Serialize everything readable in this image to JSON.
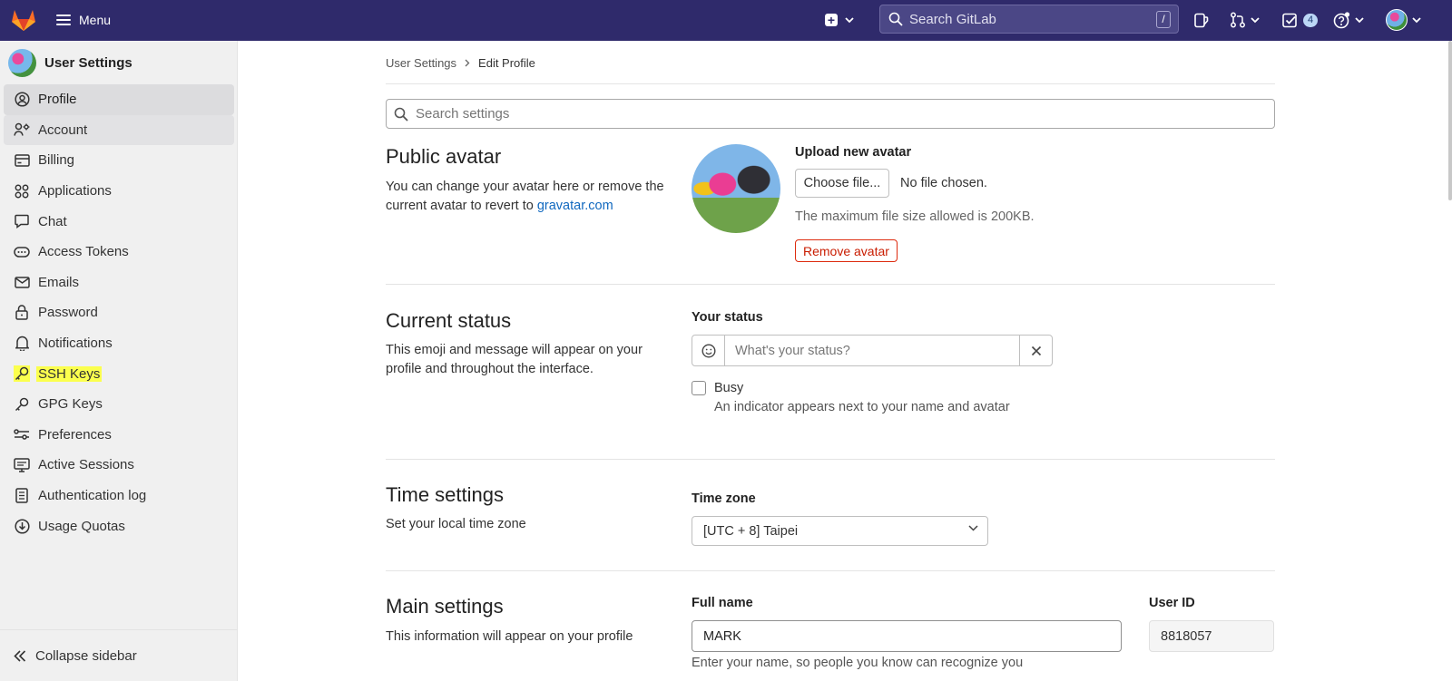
{
  "topbar": {
    "menu_label": "Menu",
    "search_placeholder": "Search GitLab",
    "search_shortcut": "/",
    "todo_count": "4",
    "brand_color": "#2f2a6b"
  },
  "sidebar": {
    "title": "User Settings",
    "items": [
      {
        "label": "Profile",
        "icon": "profile-icon"
      },
      {
        "label": "Account",
        "icon": "account-icon"
      },
      {
        "label": "Billing",
        "icon": "credit-card-icon"
      },
      {
        "label": "Applications",
        "icon": "applications-icon"
      },
      {
        "label": "Chat",
        "icon": "comment-icon"
      },
      {
        "label": "Access Tokens",
        "icon": "token-icon"
      },
      {
        "label": "Emails",
        "icon": "mail-icon"
      },
      {
        "label": "Password",
        "icon": "lock-icon"
      },
      {
        "label": "Notifications",
        "icon": "bell-icon"
      },
      {
        "label": "SSH Keys",
        "icon": "key-icon"
      },
      {
        "label": "GPG Keys",
        "icon": "key-icon"
      },
      {
        "label": "Preferences",
        "icon": "preferences-icon"
      },
      {
        "label": "Active Sessions",
        "icon": "monitor-icon"
      },
      {
        "label": "Authentication log",
        "icon": "log-icon"
      },
      {
        "label": "Usage Quotas",
        "icon": "quota-icon"
      }
    ],
    "collapse_label": "Collapse sidebar"
  },
  "breadcrumb": {
    "parent": "User Settings",
    "current": "Edit Profile"
  },
  "settings_search_placeholder": "Search settings",
  "avatar_section": {
    "title": "Public avatar",
    "description": "You can change your avatar here or remove the current avatar to revert to",
    "link_text": "gravatar.com",
    "upload_label": "Upload new avatar",
    "choose_button": "Choose file...",
    "no_file": "No file chosen.",
    "max_size": "The maximum file size allowed is 200KB.",
    "remove_button": "Remove avatar"
  },
  "status_section": {
    "title": "Current status",
    "description": "This emoji and message will appear on your profile and throughout the interface.",
    "label": "Your status",
    "placeholder": "What's your status?",
    "busy_label": "Busy",
    "busy_help": "An indicator appears next to your name and avatar"
  },
  "time_section": {
    "title": "Time settings",
    "description": "Set your local time zone",
    "label": "Time zone",
    "value": "[UTC + 8] Taipei"
  },
  "main_section": {
    "title": "Main settings",
    "description": "This information will appear on your profile",
    "fullname_label": "Full name",
    "fullname_value": "MARK",
    "userid_label": "User ID",
    "userid_value": "8818057",
    "fullname_help": "Enter your name, so people you know can recognize you"
  }
}
